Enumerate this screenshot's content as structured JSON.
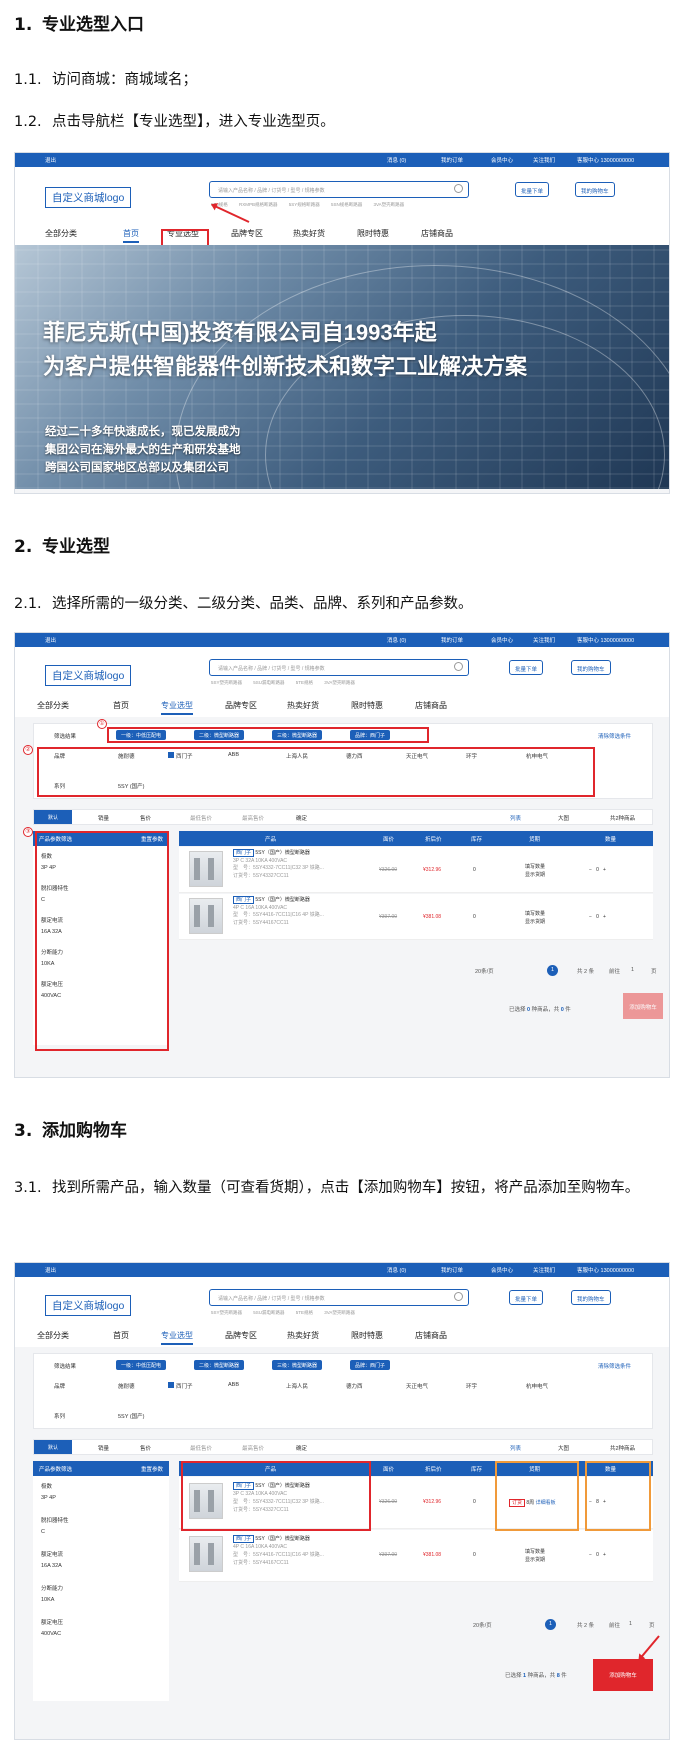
{
  "sections": [
    {
      "num": "1.",
      "title": "专业选型入口"
    },
    {
      "num": "2.",
      "title": "专业选型"
    },
    {
      "num": "3.",
      "title": "添加购物车"
    }
  ],
  "steps": {
    "s11": {
      "num": "1.1.",
      "text": "访问商城：商城域名；"
    },
    "s12": {
      "num": "1.2.",
      "text": "点击导航栏【专业选型】，进入专业选型页。"
    },
    "s21": {
      "num": "2.1.",
      "text": "选择所需的一级分类、二级分类、品类、品牌、系列和产品参数。"
    },
    "s31": {
      "num": "3.1.",
      "text": "找到所需产品，输入数量（可查看货期），点击【添加购物车】按钮，将产品添加至购物车。"
    }
  },
  "topbar": {
    "logout": "退出",
    "message": "消息 (0)",
    "orders": "我的订单",
    "member": "会员中心",
    "follow": "关注我们",
    "service": "客服中心 13000000000"
  },
  "header": {
    "logo": "自定义商城logo",
    "search_placeholder": "请输入产品名称 / 品牌 / 订货号 / 型号 / 规格参数",
    "hot_words": "5SJ规格 RXMPB规格断路器 5SY规格断路器 5SN规格断路器 3VA塑壳断路器",
    "hot_words2": "5SY塑壳断路器 5SU漏电断路器 5TE规格 3VA塑壳断路器",
    "bulk_order": "批量下单",
    "cart": "我的购物车"
  },
  "nav": {
    "all": "全部分类",
    "home": "首页",
    "pro": "专业选型",
    "brands": "品牌专区",
    "hot": "热卖好货",
    "flash": "限时特惠",
    "shop": "店铺商品"
  },
  "banner": {
    "line1": "菲尼克斯(中国)投资有限公司自1993年起",
    "line2": "为客户提供智能器件创新技术和数字工业解决方案",
    "sub1": "经过二十多年快速成长，现已发展成为",
    "sub2": "集团公司在海外最大的生产和研发基地",
    "sub3": "跨国公司国家地区总部以及集团公司"
  },
  "filter": {
    "result_label": "筛选结果",
    "tags": [
      "一级：中低压配电",
      "二级：微型断路器",
      "三级：微型断路器",
      "品牌：西门子"
    ],
    "clear": "清除筛选条件",
    "brand_label": "品牌",
    "brands": [
      "施耐德",
      "西门子",
      "ABB",
      "上海人民",
      "德力西",
      "天正电气",
      "环宇",
      "杭申电气"
    ],
    "series_label": "系列",
    "series": "5SY (国产)"
  },
  "sortbar": {
    "default": "默认",
    "sales": "销量",
    "price": "售价",
    "min_price": "最低售价",
    "max_price": "最高售价",
    "confirm": "确定",
    "list": "列表",
    "grid": "大图",
    "total": "共2种商品"
  },
  "side": {
    "title": "产品参数筛选",
    "reset": "重置参数",
    "params": [
      {
        "name": "极数",
        "values": "3P   4P"
      },
      {
        "name": "脱扣器特性",
        "values": "C"
      },
      {
        "name": "额定电流",
        "values": "16A   32A"
      },
      {
        "name": "分断能力",
        "values": "10KA"
      },
      {
        "name": "额定电压",
        "values": "400VAC"
      }
    ]
  },
  "table": {
    "headers": [
      "产品",
      "面价",
      "折后价",
      "库存",
      "货期",
      "数量"
    ],
    "rows": [
      {
        "brand": "西门子",
        "name": "5SY（国产）微型断路器",
        "spec": "3P C 32A 10KA 400VAC",
        "model": "型　号：5SY4332-7CC11|C32 3P 铁路...",
        "code": "订货号：5SY43327CC11",
        "list_price": "¥326.00",
        "price": "¥312.96",
        "stock": "0",
        "lead": "填写数量",
        "lead2": "显示货期",
        "qty": "0"
      },
      {
        "brand": "西门子",
        "name": "5SY（国产）微型断路器",
        "spec": "4P C 16A 10KA 400VAC",
        "model": "型　号：5SY4416-7CC11|C16 4P 铁路...",
        "code": "订货号：5SY44167CC11",
        "list_price": "¥397.00",
        "price": "¥381.08",
        "stock": "0",
        "lead": "填写数量",
        "lead2": "显示货期",
        "qty": "0"
      }
    ],
    "order_label": "订货",
    "order_lead": "8周",
    "order_detail": "详细看板",
    "qty_filled": "8"
  },
  "pager": {
    "per_page": "20条/页",
    "page": "1",
    "total": "共 2 条",
    "goto": "前往",
    "goto_page": "1",
    "unit": "页"
  },
  "footer_bar": {
    "selected_pre": "已选择",
    "selected_n": "0",
    "selected_mid": "种商品，共",
    "qty_n": "0",
    "qty_unit": "件",
    "selected_n3": "1",
    "qty_n3": "8",
    "add_cart": "添加购物车"
  },
  "badges": [
    "①",
    "②",
    "③"
  ],
  "colors": {
    "brand": "#1c5fb8",
    "highlight": "#e0262c",
    "orange": "#f09a3a"
  }
}
